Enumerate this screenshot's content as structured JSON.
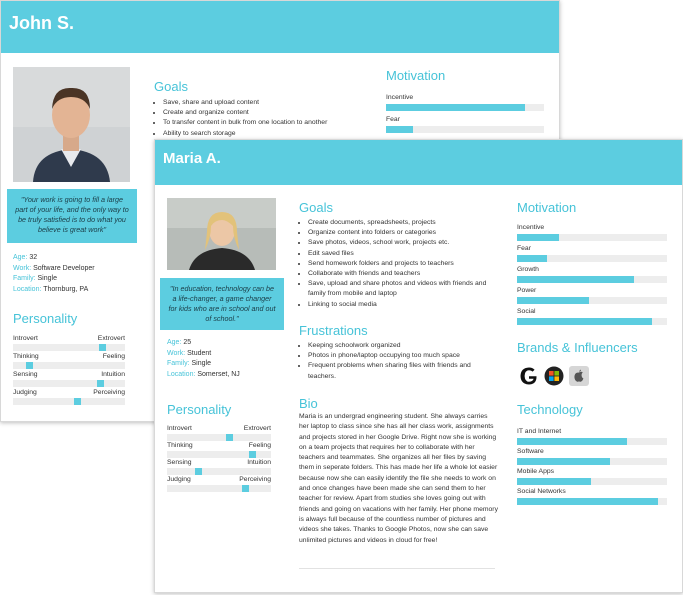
{
  "john": {
    "name": "John S.",
    "quote": "\"Your work is going to fill a large part of your life, and the only way to be truly satisfied is to do what you believe is great work\"",
    "info": [
      {
        "key": "Age:",
        "value": "32"
      },
      {
        "key": "Work:",
        "value": "Software Developer"
      },
      {
        "key": "Family:",
        "value": "Single"
      },
      {
        "key": "Location:",
        "value": "Thornburg, PA"
      }
    ],
    "personality_title": "Personality",
    "personality": [
      {
        "left": "Introvert",
        "right": "Extrovert",
        "value": 0.8
      },
      {
        "left": "Thinking",
        "right": "Feeling",
        "value": 0.15
      },
      {
        "left": "Sensing",
        "right": "Intuition",
        "value": 0.78
      },
      {
        "left": "Judging",
        "right": "Perceiving",
        "value": 0.58
      }
    ],
    "goals_title": "Goals",
    "goals": [
      "Save, share and upload content",
      "Create and organize content",
      "To transfer content in bulk from one location to another",
      "Ability to search storage"
    ],
    "motivation_title": "Motivation",
    "motivation": [
      {
        "label": "Incentive",
        "value": 0.88
      },
      {
        "label": "Fear",
        "value": 0.17
      }
    ]
  },
  "maria": {
    "name": "Maria A.",
    "quote": "\"In education, technology can be a life-changer, a game changer for kids who are in school and out of school.\"",
    "info": [
      {
        "key": "Age:",
        "value": "25"
      },
      {
        "key": "Work:",
        "value": "Student"
      },
      {
        "key": "Family:",
        "value": "Single"
      },
      {
        "key": "Location:",
        "value": "Somerset, NJ"
      }
    ],
    "personality_title": "Personality",
    "personality": [
      {
        "left": "Introvert",
        "right": "Extrovert",
        "value": 0.6
      },
      {
        "left": "Thinking",
        "right": "Feeling",
        "value": 0.82
      },
      {
        "left": "Sensing",
        "right": "Intuition",
        "value": 0.3
      },
      {
        "left": "Judging",
        "right": "Perceiving",
        "value": 0.75
      }
    ],
    "goals_title": "Goals",
    "goals": [
      "Create documents, spreadsheets, projects",
      "Organize content into folders or categories",
      "Save photos, videos, school work, projects etc.",
      "Edit saved files",
      "Send homework folders and projects to teachers",
      "Collaborate with friends and teachers",
      "Save, upload and share photos and videos with friends and family from mobile and laptop",
      "Linking to social media"
    ],
    "frustrations_title": "Frustrations",
    "frustrations": [
      "Keeping schoolwork organized",
      "Photos in phone/laptop occupying too much space",
      "Frequent problems when sharing files with friends and teachers."
    ],
    "bio_title": "Bio",
    "bio": "Maria is an undergrad engineering student. She always carries her laptop to class since she has all her class work, assignments and projects stored in her Google Drive. Right now she is working on a team projects that requires her to collaborate with her teachers and teammates. She organizes all her files by saving them in seperate folders. This has made her life a whole lot easier because now she can easily identify the file she needs to work on and once changes have been made she can send them to her teacher for review. Apart from studies she loves going out with friends and going on vacations with her family. Her phone memory is always full because of the countless number of pictures and videos she takes. Thanks to Google Photos, now she can save unlimited pictures and videos in cloud for free!",
    "motivation_title": "Motivation",
    "motivation": [
      {
        "label": "Incentive",
        "value": 0.28
      },
      {
        "label": "Fear",
        "value": 0.2
      },
      {
        "label": "Growth",
        "value": 0.78
      },
      {
        "label": "Power",
        "value": 0.48
      },
      {
        "label": "Social",
        "value": 0.9
      }
    ],
    "brands_title": "Brands & Influencers",
    "brands": [
      "google-logo-icon",
      "microsoft-office-logo-icon",
      "apple-logo-icon"
    ],
    "technology_title": "Technology",
    "technology": [
      {
        "label": "IT and Internet",
        "value": 0.73
      },
      {
        "label": "Software",
        "value": 0.62
      },
      {
        "label": "Mobile Apps",
        "value": 0.49
      },
      {
        "label": "Social Networks",
        "value": 0.94
      }
    ]
  }
}
